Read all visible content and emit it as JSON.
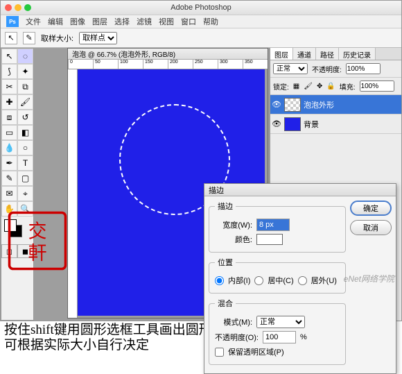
{
  "titlebar": {
    "app": "Adobe Photoshop"
  },
  "menu": [
    "文件",
    "编辑",
    "图像",
    "图层",
    "选择",
    "滤镜",
    "视图",
    "窗口",
    "帮助"
  ],
  "optionsbar": {
    "sample_label": "取样大小:",
    "sample_value": "取样点"
  },
  "document": {
    "title": "泡泡 @ 66.7% (泡泡外形, RGB/8)",
    "ruler_marks": [
      "0",
      "50",
      "100",
      "150",
      "200",
      "250",
      "300",
      "350"
    ]
  },
  "panels": {
    "tabs": [
      "图层",
      "通道",
      "路径",
      "历史记录"
    ],
    "blend_mode": "正常",
    "opacity_label": "不透明度:",
    "opacity_value": "100%",
    "lock_label": "锁定:",
    "fill_label": "填充:",
    "fill_value": "100%",
    "layers": [
      {
        "name": "泡泡外形",
        "thumb": "checker",
        "selected": true
      },
      {
        "name": "背景",
        "thumb": "blue",
        "selected": false
      }
    ]
  },
  "dialog": {
    "title": "描边",
    "ok": "确定",
    "cancel": "取消",
    "stroke_legend": "描边",
    "width_label": "宽度(W):",
    "width_value": "8 px",
    "color_label": "颜色:",
    "position_legend": "位置",
    "pos_inside": "内部(I)",
    "pos_center": "居中(C)",
    "pos_outside": "居外(U)",
    "blend_legend": "混合",
    "mode_label": "模式(M):",
    "mode_value": "正常",
    "opacity_label": "不透明度(O):",
    "opacity_value": "100",
    "opacity_unit": "%",
    "preserve": "保留透明区域(P)"
  },
  "caption": "按住shift键用圆形选框工具画出圆形选框，并用白色描边，具体参数可根据实际大小自行决定",
  "watermark": "eNet网络学院"
}
